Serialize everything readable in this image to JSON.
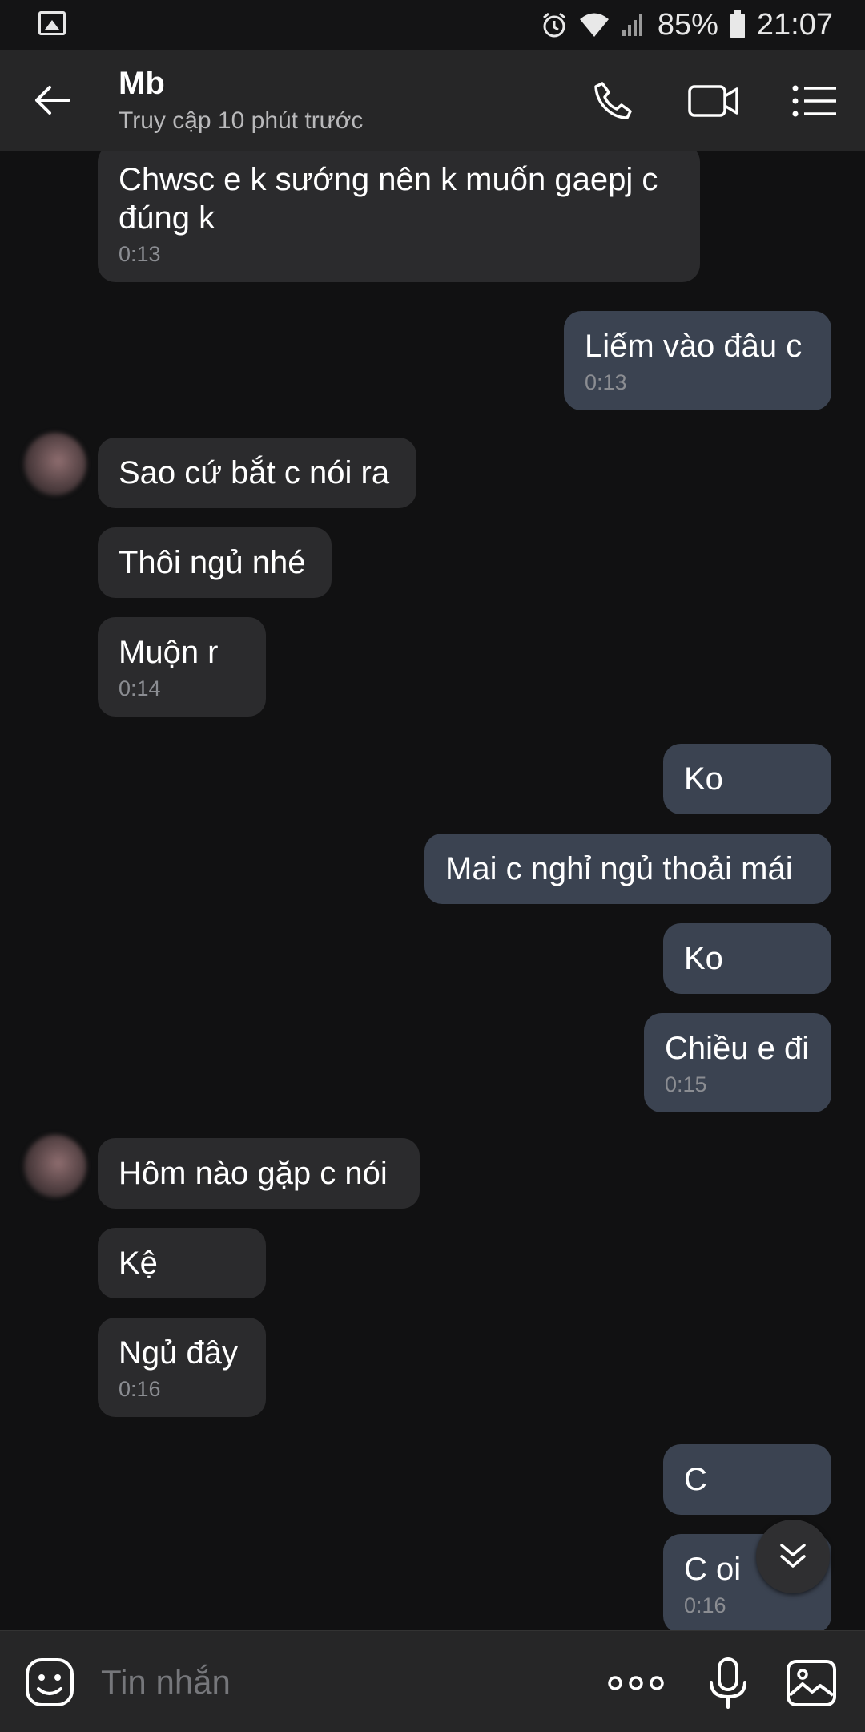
{
  "status_bar": {
    "left_icon": "image-icon",
    "alarm_icon": "alarm-icon",
    "wifi_icon": "wifi-icon",
    "signal_icon": "signal-icon",
    "battery_percent": "85%",
    "battery_icon": "battery-icon",
    "time": "21:07"
  },
  "header": {
    "contact_name": "Mb",
    "last_seen": "Truy cập 10 phút trước",
    "icons": [
      "back-arrow-icon",
      "phone-icon",
      "video-call-icon",
      "menu-list-icon"
    ]
  },
  "messages": [
    {
      "side": "in",
      "text": "Chwsc e k sướng nên k muốn gaepj c\nđúng k",
      "time": "0:13"
    },
    {
      "side": "out",
      "text": "Liếm vào đâu c",
      "time": "0:13"
    },
    {
      "side": "in",
      "text": "Sao cứ bắt c nói ra",
      "time": ""
    },
    {
      "side": "in",
      "text": "Thôi ngủ nhé",
      "time": ""
    },
    {
      "side": "in",
      "text": "Muộn r",
      "time": "0:14"
    },
    {
      "side": "out",
      "text": "Ko",
      "time": ""
    },
    {
      "side": "out",
      "text": "Mai c nghỉ ngủ thoải mái",
      "time": ""
    },
    {
      "side": "out",
      "text": "Ko",
      "time": ""
    },
    {
      "side": "out",
      "text": "Chiều e đi",
      "time": "0:15"
    },
    {
      "side": "in",
      "text": "Hôm nào gặp c nói",
      "time": ""
    },
    {
      "side": "in",
      "text": "Kệ",
      "time": ""
    },
    {
      "side": "in",
      "text": "Ngủ đây",
      "time": "0:16"
    },
    {
      "side": "out",
      "text": "C",
      "time": ""
    },
    {
      "side": "out",
      "text": "C oi",
      "time": "0:16"
    }
  ],
  "scroll_down_icon": "double-chevron-down-icon",
  "input": {
    "placeholder": "Tin nhắn",
    "icons": [
      "sticker-icon",
      "more-dots-icon",
      "microphone-icon",
      "gallery-icon"
    ]
  }
}
